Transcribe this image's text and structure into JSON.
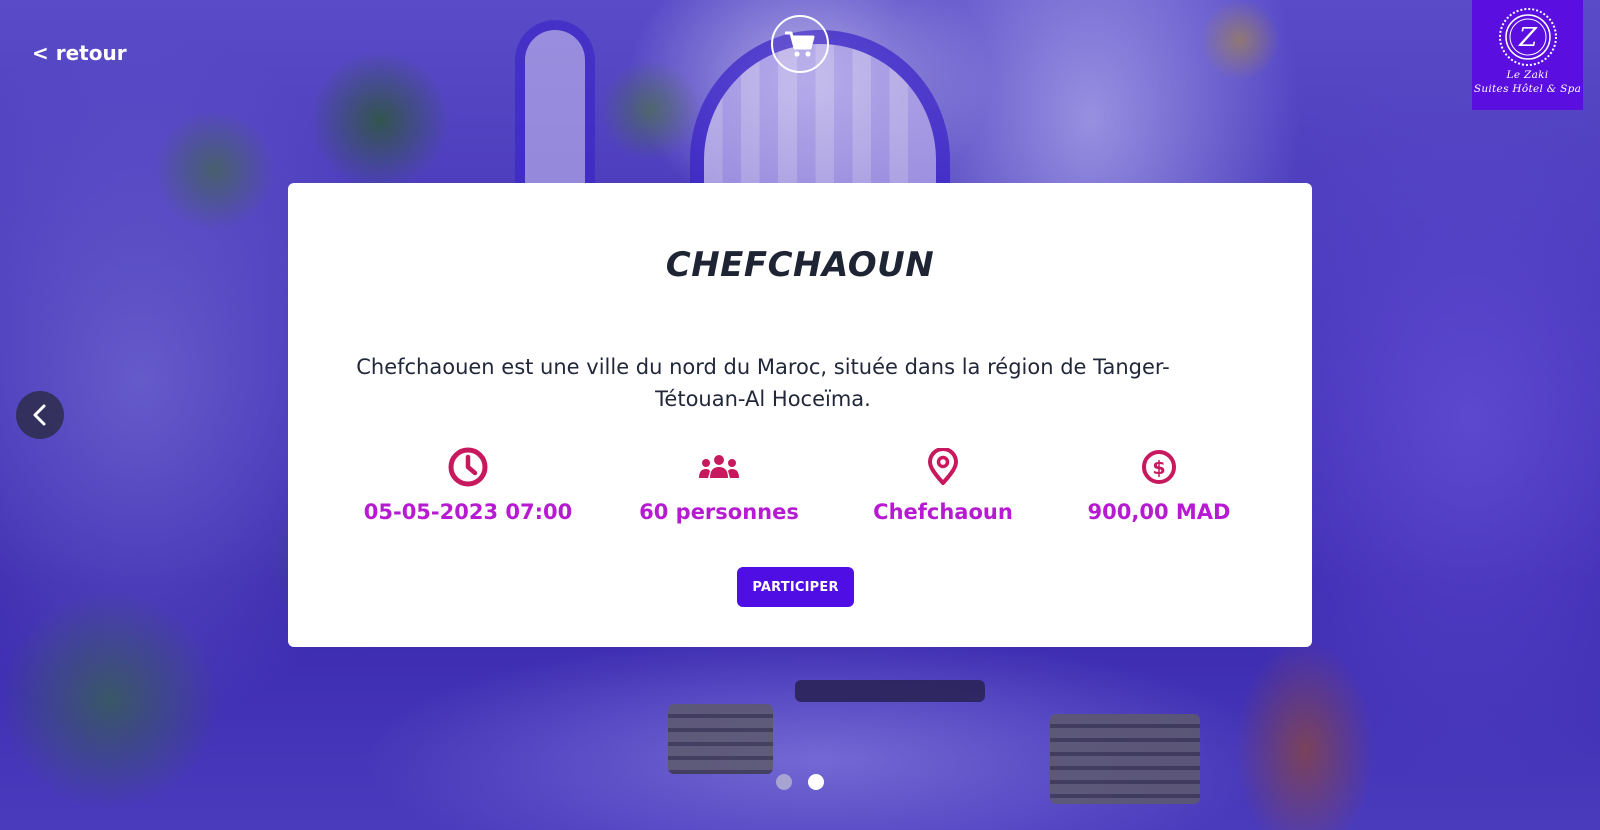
{
  "nav": {
    "back_label": "< retour"
  },
  "logo": {
    "initial": "Z",
    "line1": "Le Zaki",
    "line2": "Suites Hôtel & Spa"
  },
  "activity": {
    "title": "CHEFCHAOUN",
    "description_line1": "Chefchaouen est une ville du nord du Maroc, située dans la région de Tanger-",
    "description_line2": "Tétouan-Al Hoceïma.",
    "date": "05-05-2023 07:00",
    "capacity": "60 personnes",
    "location": "Chefchaoun",
    "price": "900,00 MAD",
    "participate_label": "PARTICIPER"
  },
  "icons": {
    "cart": "cart-icon",
    "prev": "chevron-left-icon",
    "date": "clock-icon",
    "capacity": "users-icon",
    "location": "map-pin-icon",
    "price": "dollar-icon"
  },
  "carousel": {
    "slides": 2,
    "active_index": 1
  },
  "colors": {
    "accent": "#b61bd1",
    "icon": "#c8195f",
    "button": "#4f0ee3",
    "logo_bg": "#5a0fe0"
  }
}
